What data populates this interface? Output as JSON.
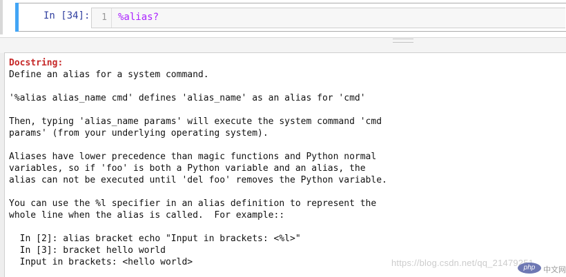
{
  "cell": {
    "prompt": "In [34]:",
    "line_number": "1",
    "code_magic": "%alias",
    "code_query": "?"
  },
  "pager": {
    "heading": "Docstring:",
    "lines": [
      "Define an alias for a system command.",
      "",
      "'%alias alias_name cmd' defines 'alias_name' as an alias for 'cmd'",
      "",
      "Then, typing 'alias_name params' will execute the system command 'cmd",
      "params' (from your underlying operating system).",
      "",
      "Aliases have lower precedence than magic functions and Python normal",
      "variables, so if 'foo' is both a Python variable and an alias, the",
      "alias can not be executed until 'del foo' removes the Python variable.",
      "",
      "You can use the %l specifier in an alias definition to represent the",
      "whole line when the alias is called.  For example::",
      "",
      "  In [2]: alias bracket echo \"Input in brackets: <%l>\"",
      "  In [3]: bracket hello world",
      "  Input in brackets: <hello world>"
    ]
  },
  "watermark": {
    "text": "https://blog.csdn.net/qq_21479251",
    "logo_text": "php",
    "logo_caption": "中文网"
  }
}
